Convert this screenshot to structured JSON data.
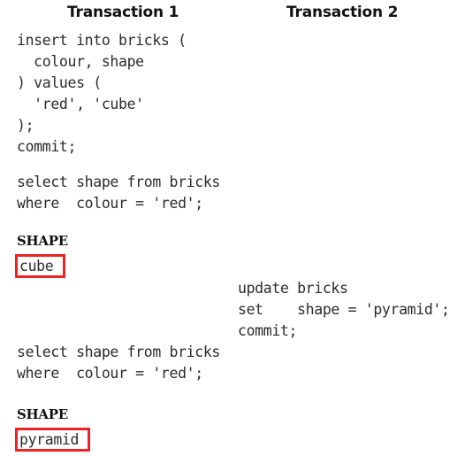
{
  "page": {
    "background": "#ffffff",
    "code_color": "#2b2b2b",
    "highlight_color": "#ee2222",
    "header_color": "#111111"
  },
  "columns": {
    "transaction1": {
      "header": "Transaction 1",
      "statements": {
        "insert": "insert into bricks (\n  colour, shape\n) values (\n  'red', 'cube'\n);\ncommit;",
        "select_first": "select shape from bricks\nwhere  colour = 'red';",
        "select_second": "select shape from bricks\nwhere  colour = 'red';"
      },
      "results": [
        {
          "column_header": "SHAPE",
          "value": "cube",
          "highlighted": true
        },
        {
          "column_header": "SHAPE",
          "value": "pyramid",
          "highlighted": true
        }
      ]
    },
    "transaction2": {
      "header": "Transaction 2",
      "statements": {
        "update": "update bricks\nset    shape = 'pyramid';\ncommit;"
      }
    }
  }
}
